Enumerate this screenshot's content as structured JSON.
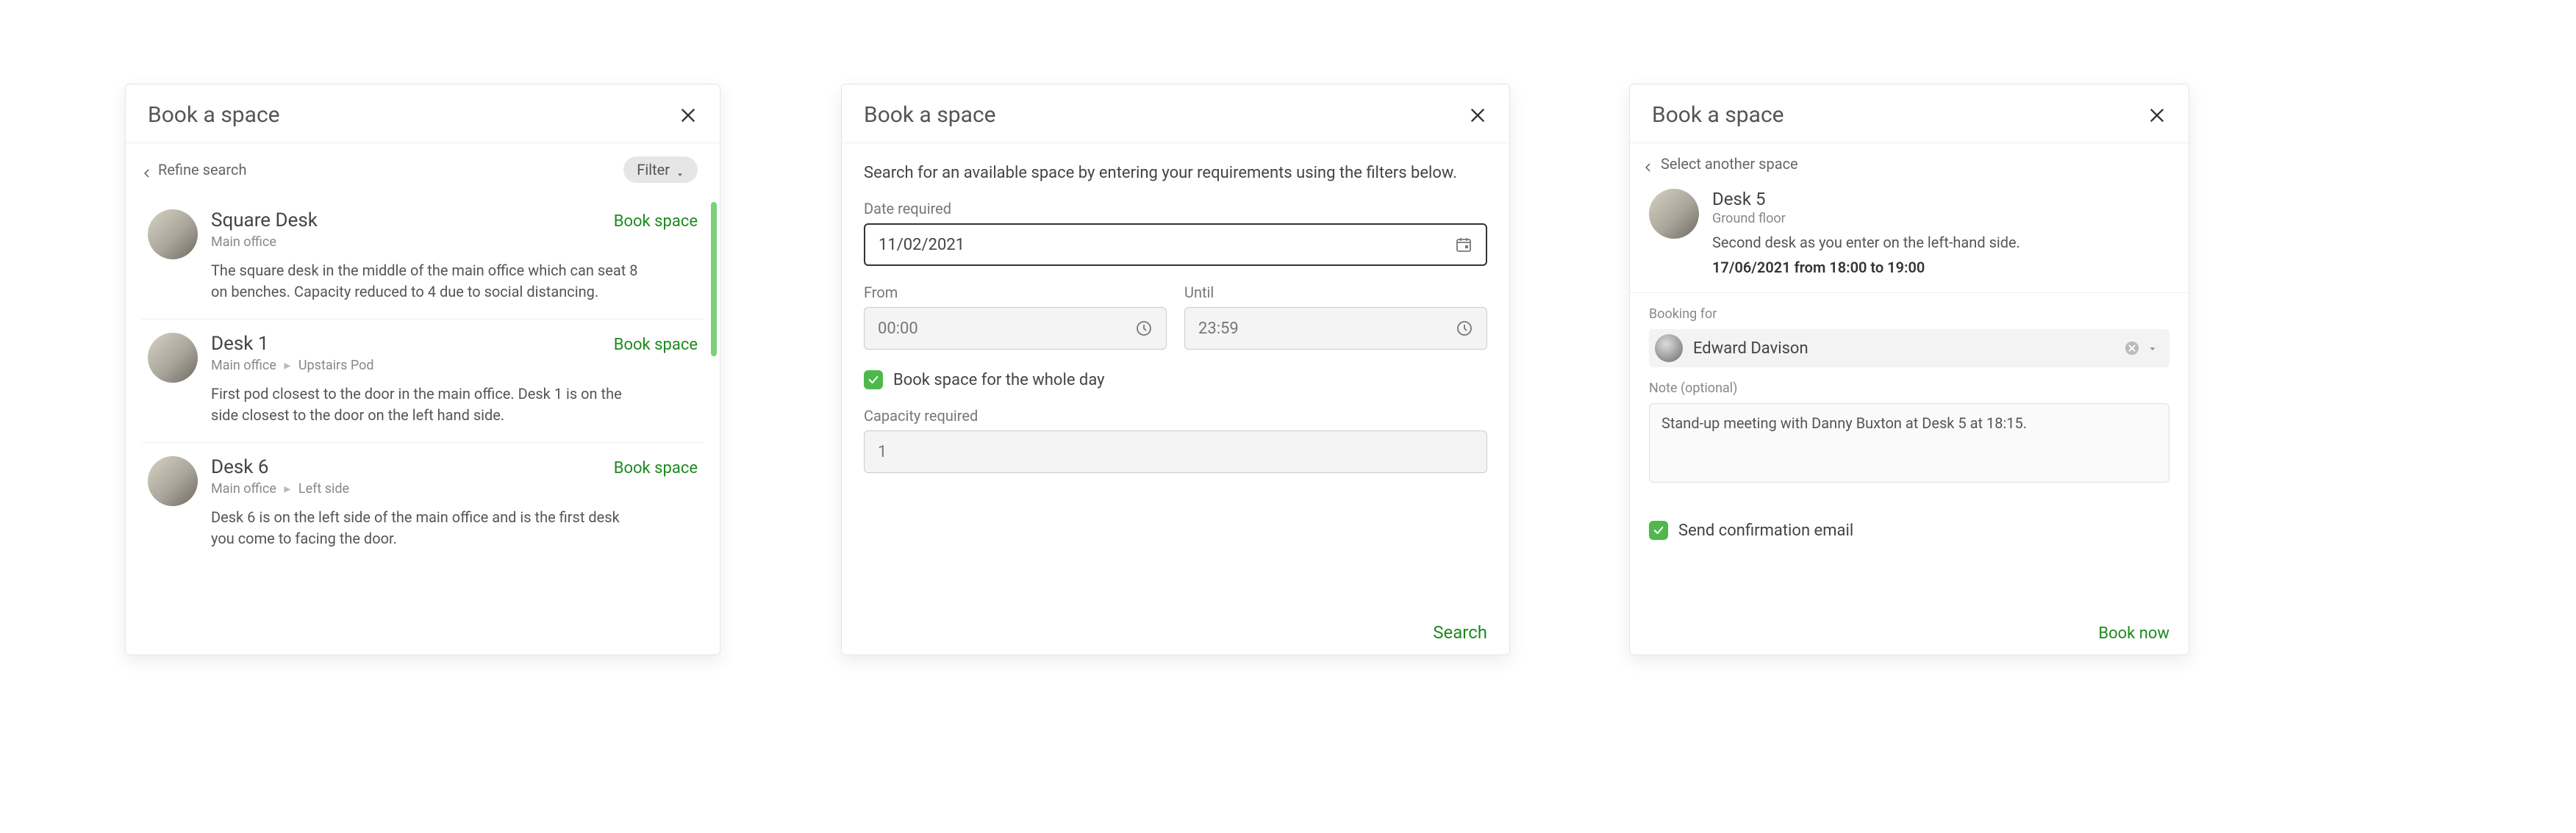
{
  "panel1": {
    "title": "Book a space",
    "back_label": "Refine search",
    "filter_label": "Filter",
    "results": [
      {
        "name": "Square Desk",
        "path_1": "Main office",
        "desc": "The square desk in the middle of the main office which can seat 8 on benches. Capacity reduced to 4 due to social distancing.",
        "cta": "Book space"
      },
      {
        "name": "Desk 1",
        "path_1": "Main office",
        "path_2": "Upstairs Pod",
        "desc": "First pod closest to the door in the main office. Desk 1 is on the side closest to the door on the left hand side.",
        "cta": "Book space"
      },
      {
        "name": "Desk 6",
        "path_1": "Main office",
        "path_2": "Left side",
        "desc": "Desk 6 is on the left side of the main office and is the first desk you come to facing the door.",
        "cta": "Book space"
      }
    ]
  },
  "panel2": {
    "title": "Book a space",
    "hint": "Search for an available space by entering your requirements using the filters below.",
    "date_label": "Date required",
    "date_value": "11/02/2021",
    "from_label": "From",
    "from_value": "00:00",
    "until_label": "Until",
    "until_value": "23:59",
    "whole_day_label": "Book space for the whole day",
    "capacity_label": "Capacity required",
    "capacity_value": "1",
    "search_label": "Search"
  },
  "panel3": {
    "title": "Book a space",
    "back_label": "Select another space",
    "space_name": "Desk 5",
    "space_location": "Ground floor",
    "space_desc": "Second desk as you enter on the left-hand side.",
    "space_when": "17/06/2021 from 18:00 to 19:00",
    "booking_for_label": "Booking for",
    "person_name": "Edward Davison",
    "note_label": "Note (optional)",
    "note_value": "Stand-up meeting with Danny Buxton at Desk 5 at 18:15.",
    "confirm_label": "Send confirmation email",
    "cta": "Book now"
  }
}
